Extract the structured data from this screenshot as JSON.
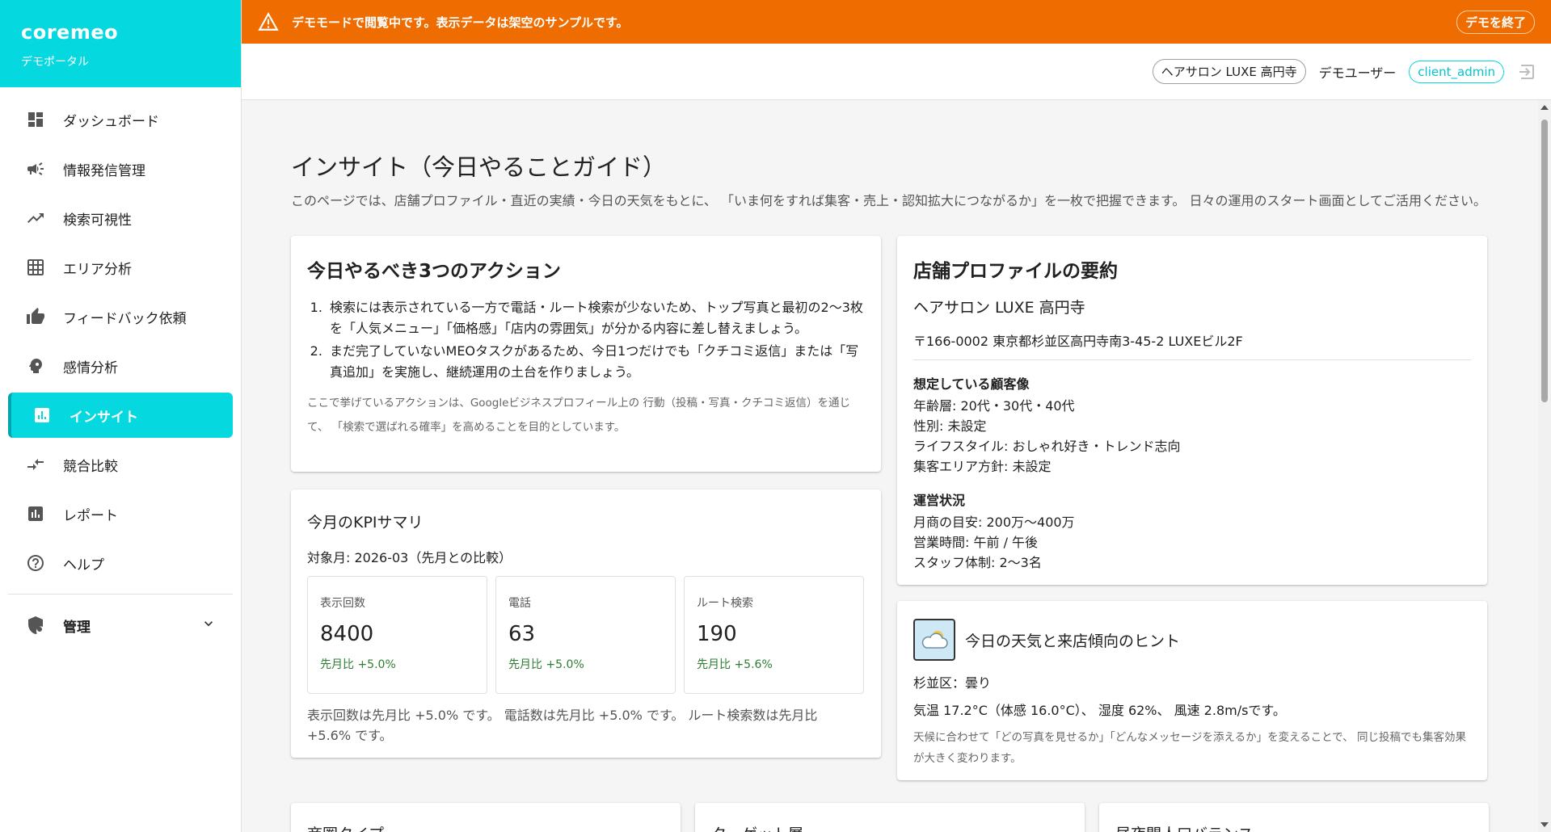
{
  "brand": {
    "name": "coremeo",
    "subtitle": "デモポータル"
  },
  "nav": [
    {
      "label": "ダッシュボード",
      "icon": "dashboard-icon"
    },
    {
      "label": "情報発信管理",
      "icon": "megaphone-icon"
    },
    {
      "label": "検索可視性",
      "icon": "trending-up-icon"
    },
    {
      "label": "エリア分析",
      "icon": "grid-icon"
    },
    {
      "label": "フィードバック依頼",
      "icon": "thumb-up-icon"
    },
    {
      "label": "感情分析",
      "icon": "psychology-icon"
    },
    {
      "label": "インサイト",
      "icon": "insights-icon",
      "active": true
    },
    {
      "label": "競合比較",
      "icon": "compare-arrows-icon"
    },
    {
      "label": "レポート",
      "icon": "bar-chart-icon"
    },
    {
      "label": "ヘルプ",
      "icon": "help-icon"
    }
  ],
  "admin": {
    "label": "管理"
  },
  "banner": {
    "text": "デモモードで閲覧中です。表示データは架空のサンプルです。",
    "end_label": "デモを終了",
    "color": "#ef6c00"
  },
  "topbar": {
    "store": "ヘアサロン LUXE 高円寺",
    "user": "デモユーザー",
    "role": "client_admin"
  },
  "page": {
    "title": "インサイト（今日やることガイド）",
    "description": "このページでは、店舗プロファイル・直近の実績・今日の天気をもとに、 「いま何をすれば集客・売上・認知拡大につながるか」を一枚で把握できます。 日々の運用のスタート画面としてご活用ください。"
  },
  "actions": {
    "title": "今日やるべき3つのアクション",
    "items": [
      "検索には表示されている一方で電話・ルート検索が少ないため、トップ写真と最初の2〜3枚を「人気メニュー」「価格感」「店内の雰囲気」が分かる内容に差し替えましょう。",
      "まだ完了していないMEOタスクがあるため、今日1つだけでも「クチコミ返信」または「写真追加」を実施し、継続運用の土台を作りましょう。"
    ],
    "note": "ここで挙げているアクションは、Googleビジネスプロフィール上の 行動（投稿・写真・クチコミ返信）を通じて、 「検索で選ばれる確率」を高めることを目的としています。"
  },
  "kpi": {
    "title": "今月のKPIサマリ",
    "period": "対象月: 2026-03（先月との比較）",
    "boxes": [
      {
        "label": "表示回数",
        "value": "8400",
        "diff": "先月比 +5.0%"
      },
      {
        "label": "電話",
        "value": "63",
        "diff": "先月比 +5.0%"
      },
      {
        "label": "ルート検索",
        "value": "190",
        "diff": "先月比 +5.6%"
      }
    ],
    "summary": "表示回数は先月比 +5.0% です。 電話数は先月比 +5.0% です。 ルート検索数は先月比 +5.6% です。"
  },
  "profile": {
    "title": "店舗プロファイルの要約",
    "store_name": "ヘアサロン LUXE 高円寺",
    "address": "〒166-0002 東京都杉並区高円寺南3-45-2 LUXEビル2F",
    "customer_title": "想定している顧客像",
    "customer_lines": [
      "年齢層: 20代・30代・40代",
      "性別: 未設定",
      "ライフスタイル: おしゃれ好き・トレンド志向",
      "集客エリア方針: 未設定"
    ],
    "ops_title": "運営状況",
    "ops_lines": [
      "月商の目安: 200万〜400万",
      "営業時間: 午前 / 午後",
      "スタッフ体制: 2〜3名"
    ]
  },
  "weather": {
    "title": "今日の天気と来店傾向のヒント",
    "condition": "杉並区：曇り",
    "detail": "気温 17.2°C（体感 16.0°C）、 湿度 62%、 風速 2.8m/sです。",
    "hint": "天候に合わせて「どの写真を見せるか」「どんなメッセージを添えるか」を変えることで、 同じ投稿でも集客効果が大きく変わります。"
  },
  "bottom": [
    {
      "title": "商圏タイプ"
    },
    {
      "title": "ターゲット層"
    },
    {
      "title": "昼夜間人口バランス"
    }
  ]
}
